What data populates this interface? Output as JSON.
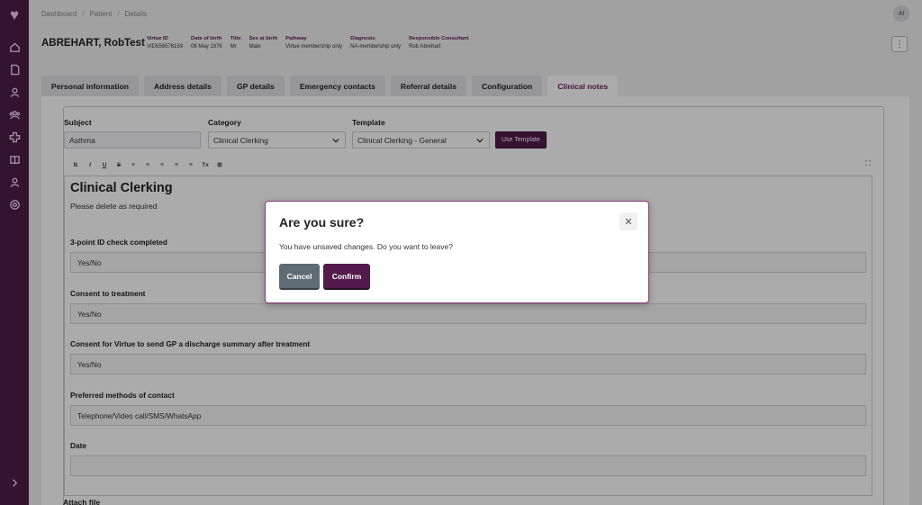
{
  "breadcrumb": [
    "Dashboard",
    "Patient",
    "Details"
  ],
  "user_initials": "AI",
  "patient": {
    "name": "ABREHART, RobTest",
    "fields": [
      {
        "label": "Virtue ID",
        "value": "VID556578159"
      },
      {
        "label": "Date of birth",
        "value": "08 May 1976"
      },
      {
        "label": "Title",
        "value": "Mr"
      },
      {
        "label": "Sex at birth",
        "value": "Male"
      },
      {
        "label": "Pathway",
        "value": "Virtue membership only"
      },
      {
        "label": "Diagnosis",
        "value": "NA-membership only"
      },
      {
        "label": "Responsible Consultant",
        "value": "Rob Abrehart"
      }
    ]
  },
  "tabs": [
    "Personal information",
    "Address details",
    "GP details",
    "Emergency contacts",
    "Referral details",
    "Configuration",
    "Clinical notes"
  ],
  "active_tab": "Clinical notes",
  "form": {
    "subject_label": "Subject",
    "subject_value": "Asthma",
    "category_label": "Category",
    "category_value": "Clinical Clerking",
    "template_label": "Template",
    "template_value": "Clinical Clerking - General",
    "use_template": "Use Template",
    "toolbar": [
      "B",
      "I",
      "U",
      "S",
      "≡",
      "≡",
      "≡",
      "≡",
      "≡",
      "Tx",
      "⊞"
    ]
  },
  "editor": {
    "title": "Clinical Clerking",
    "subtitle": "Please delete as required",
    "questions": [
      {
        "q": "3-point ID check completed",
        "a": "Yes/No"
      },
      {
        "q": "Consent to treatment",
        "a": "Yes/No"
      },
      {
        "q": "Consent for Virtue to send GP a discharge summary after treatment",
        "a": "Yes/No"
      },
      {
        "q": "Preferred methods of contact",
        "a": "Telephone/Video call/SMS/WhatsApp"
      },
      {
        "q": "Date",
        "a": ""
      }
    ]
  },
  "attach_label": "Attach file",
  "modal": {
    "title": "Are you sure?",
    "message": "You have unsaved changes. Do you want to leave?",
    "cancel": "Cancel",
    "confirm": "Confirm"
  },
  "colors": {
    "brand": "#521b4b",
    "sidebar": "#4c1d45",
    "cancel": "#5f6b75"
  }
}
